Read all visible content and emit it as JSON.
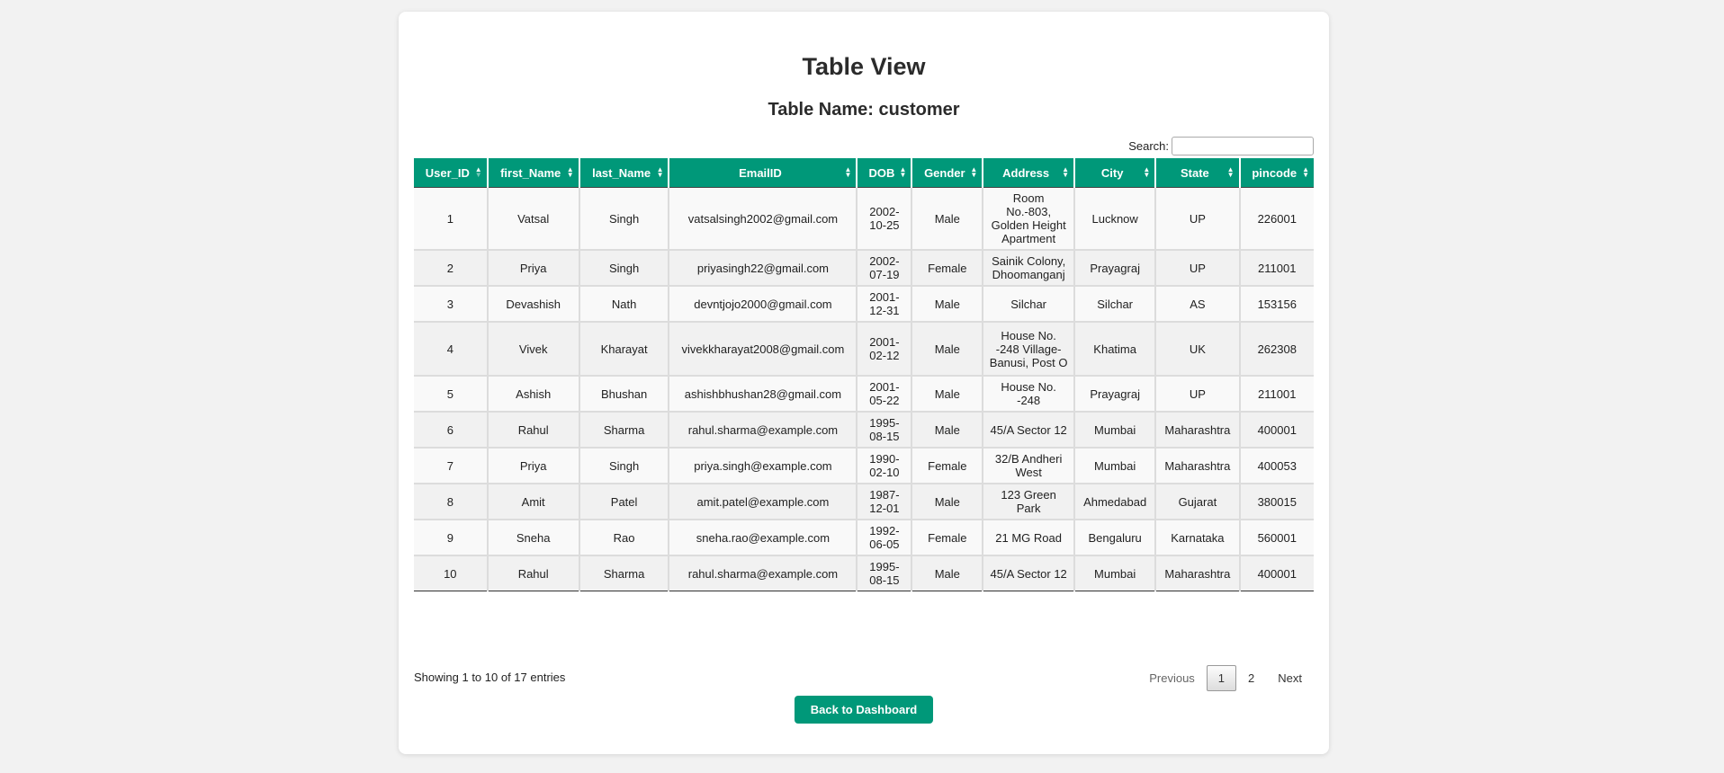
{
  "page": {
    "title": "Table View",
    "table_name": "Table Name: customer",
    "search_label": "Search:",
    "search_value": "",
    "accent_color": "#009879"
  },
  "table": {
    "columns": [
      "User_ID",
      "first_Name",
      "last_Name",
      "EmailID",
      "DOB",
      "Gender",
      "Address",
      "City",
      "State",
      "pincode"
    ],
    "sorted_column": "User_ID",
    "sort_direction": "asc",
    "rows": [
      [
        "1",
        "Vatsal",
        "Singh",
        "vatsalsingh2002@gmail.com",
        "2002-10-25",
        "Male",
        "Room No.-803, Golden Height Apartment",
        "Lucknow",
        "UP",
        "226001"
      ],
      [
        "2",
        "Priya",
        "Singh",
        "priyasingh22@gmail.com",
        "2002-07-19",
        "Female",
        "Sainik Colony, Dhoomanganj",
        "Prayagraj",
        "UP",
        "211001"
      ],
      [
        "3",
        "Devashish",
        "Nath",
        "devntjojo2000@gmail.com",
        "2001-12-31",
        "Male",
        "Silchar",
        "Silchar",
        "AS",
        "153156"
      ],
      [
        "4",
        "Vivek",
        "Kharayat",
        "vivekkharayat2008@gmail.com",
        "2001-02-12",
        "Male",
        "House No. -248 Village-Banusi, Post O",
        "Khatima",
        "UK",
        "262308"
      ],
      [
        "5",
        "Ashish",
        "Bhushan",
        "ashishbhushan28@gmail.com",
        "2001-05-22",
        "Male",
        "House No. -248",
        "Prayagraj",
        "UP",
        "211001"
      ],
      [
        "6",
        "Rahul",
        "Sharma",
        "rahul.sharma@example.com",
        "1995-08-15",
        "Male",
        "45/A Sector 12",
        "Mumbai",
        "Maharashtra",
        "400001"
      ],
      [
        "7",
        "Priya",
        "Singh",
        "priya.singh@example.com",
        "1990-02-10",
        "Female",
        "32/B Andheri West",
        "Mumbai",
        "Maharashtra",
        "400053"
      ],
      [
        "8",
        "Amit",
        "Patel",
        "amit.patel@example.com",
        "1987-12-01",
        "Male",
        "123 Green Park",
        "Ahmedabad",
        "Gujarat",
        "380015"
      ],
      [
        "9",
        "Sneha",
        "Rao",
        "sneha.rao@example.com",
        "1992-06-05",
        "Female",
        "21 MG Road",
        "Bengaluru",
        "Karnataka",
        "560001"
      ],
      [
        "10",
        "Rahul",
        "Sharma",
        "rahul.sharma@example.com",
        "1995-08-15",
        "Male",
        "45/A Sector 12",
        "Mumbai",
        "Maharashtra",
        "400001"
      ]
    ]
  },
  "footer": {
    "info": "Showing 1 to 10 of 17 entries",
    "pagination": {
      "previous": "Previous",
      "pages": [
        "1",
        "2"
      ],
      "current": "1",
      "next": "Next"
    },
    "back_button": "Back to Dashboard"
  }
}
